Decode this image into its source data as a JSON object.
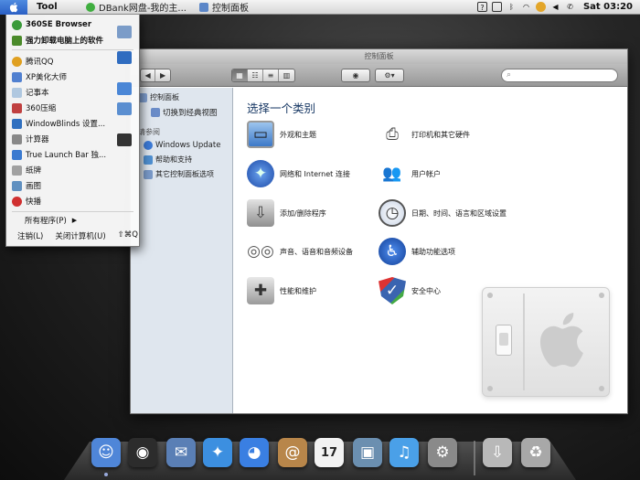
{
  "menubar": {
    "app_menu": "Tool",
    "tasks": [
      "DBank网盘-我的主...",
      "控制面板"
    ],
    "clock": "Sat 03:20"
  },
  "start_menu": {
    "items": [
      {
        "label": "360SE Browser",
        "bold": true,
        "icon": "globe-icon",
        "color": "#3a9a3a"
      },
      {
        "label": "强力卸载电脑上的软件",
        "bold": true,
        "icon": "uninstall-icon",
        "color": "#4a8a2a"
      },
      {
        "label": "腾讯QQ",
        "bold": false,
        "icon": "qq-icon",
        "color": "#e0a020"
      },
      {
        "label": "XP美化大师",
        "bold": false,
        "icon": "xp-icon",
        "color": "#5080d0"
      },
      {
        "label": "记事本",
        "bold": false,
        "icon": "notepad-icon",
        "color": "#b0c8e0"
      },
      {
        "label": "360压缩",
        "bold": false,
        "icon": "archive-icon",
        "color": "#c04040"
      },
      {
        "label": "WindowBlinds 设置...",
        "bold": false,
        "icon": "windowblinds-icon",
        "color": "#3070c0"
      },
      {
        "label": "计算器",
        "bold": false,
        "icon": "calculator-icon",
        "color": "#888888"
      },
      {
        "label": "True Launch Bar 独...",
        "bold": false,
        "icon": "launchbar-icon",
        "color": "#3a7ad0"
      },
      {
        "label": "纸牌",
        "bold": false,
        "icon": "cards-icon",
        "color": "#a0a0a0"
      },
      {
        "label": "画图",
        "bold": false,
        "icon": "paint-icon",
        "color": "#6090c0"
      },
      {
        "label": "快播",
        "bold": false,
        "icon": "qvod-icon",
        "color": "#d03030"
      }
    ],
    "all_programs": "所有程序(P)",
    "logout": "注销(L)",
    "shutdown": "关闭计算机(U)",
    "quit_shortcut": "⇧⌘Q"
  },
  "window": {
    "title": "控制面板",
    "search_placeholder": "",
    "sidebar": {
      "panel_title": "控制面板",
      "switch_view": "切换到经典视图",
      "see_also": "请参阅",
      "links": [
        "Windows Update",
        "帮助和支持",
        "其它控制面板选项"
      ]
    },
    "heading": "选择一个类别",
    "categories": [
      {
        "label": "外观和主题",
        "icon": "monitor-icon",
        "color": "#6aa0d8"
      },
      {
        "label": "打印机和其它硬件",
        "icon": "printer-icon",
        "color": "#666666"
      },
      {
        "label": "网络和 Internet 连接",
        "icon": "network-globe-icon",
        "color": "#2f5fb8"
      },
      {
        "label": "用户帐户",
        "icon": "users-icon",
        "color": "#222222"
      },
      {
        "label": "添加/删除程序",
        "icon": "install-icon",
        "color": "#8a8a8a"
      },
      {
        "label": "日期、时间、语言和区域设置",
        "icon": "clock-icon",
        "color": "#d0d8e8"
      },
      {
        "label": "声音、语音和音频设备",
        "icon": "speakers-icon",
        "color": "#bbbbbb"
      },
      {
        "label": "辅助功能选项",
        "icon": "accessibility-icon",
        "color": "#1f62c8"
      },
      {
        "label": "性能和维护",
        "icon": "maintenance-icon",
        "color": "#999999"
      },
      {
        "label": "安全中心",
        "icon": "shield-icon",
        "color": "#3a64b0"
      }
    ]
  },
  "dock": {
    "items": [
      {
        "name": "finder-icon",
        "color": "#4f86d8",
        "glyph": "☺"
      },
      {
        "name": "dashboard-icon",
        "color": "#2c2c2c",
        "glyph": "◉"
      },
      {
        "name": "mail-icon",
        "color": "#5a7fb5",
        "glyph": "✉"
      },
      {
        "name": "safari-icon",
        "color": "#3c8fe0",
        "glyph": "✦"
      },
      {
        "name": "ichat-icon",
        "color": "#3a7fe2",
        "glyph": "◕"
      },
      {
        "name": "address-book-icon",
        "color": "#b8864a",
        "glyph": "@"
      },
      {
        "name": "ical-icon",
        "color": "#f2f2f2",
        "glyph": "17"
      },
      {
        "name": "iphoto-icon",
        "color": "#6b8fb0",
        "glyph": "▣"
      },
      {
        "name": "itunes-icon",
        "color": "#4aa0e8",
        "glyph": "♫"
      },
      {
        "name": "system-prefs-icon",
        "color": "#8a8a8a",
        "glyph": "⚙"
      },
      {
        "name": "downloads-stack-icon",
        "color": "#b8b8b8",
        "glyph": "⇩"
      },
      {
        "name": "trash-icon",
        "color": "#a8a8a8",
        "glyph": "♻"
      }
    ]
  }
}
